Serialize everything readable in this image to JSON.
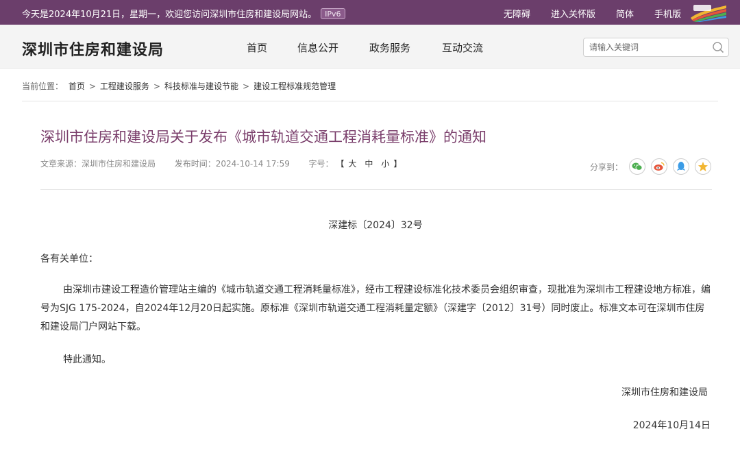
{
  "topbar": {
    "welcome": "今天是2024年10月21日，星期一，欢迎您访问深圳市住房和建设局网站。",
    "ipv6_badge": "IPv6",
    "links": [
      "无障碍",
      "进入关怀版",
      "简体",
      "手机版"
    ]
  },
  "header": {
    "site_title": "深圳市住房和建设局",
    "nav": [
      "首页",
      "信息公开",
      "政务服务",
      "互动交流"
    ],
    "search_placeholder": "请输入关键词"
  },
  "breadcrumb": {
    "prefix": "当前位置：",
    "items": [
      "首页",
      "工程建设服务",
      "科技标准与建设节能",
      "建设工程标准规范管理"
    ],
    "separator": ">"
  },
  "article": {
    "title": "深圳市住房和建设局关于发布《城市轨道交通工程消耗量标准》的通知",
    "source_label": "文章来源：",
    "source": "深圳市住房和建设局",
    "date_label": "发布时间：",
    "date": "2024-10-14 17:59",
    "font_label": "字号：",
    "font_open": "【",
    "font_sizes": [
      "大",
      "中",
      "小"
    ],
    "font_close": "】",
    "share_label": "分享到：",
    "share_icons": [
      "wechat-icon",
      "weibo-icon",
      "qq-icon",
      "qzone-icon"
    ],
    "doc_number": "深建标〔2024〕32号",
    "salutation": "各有关单位：",
    "body": "由深圳市建设工程造价管理站主编的《城市轨道交通工程消耗量标准》，经市工程建设标准化技术委员会组织审查，现批准为深圳市工程建设地方标准，编号为SJG 175-2024，自2024年12月20日起实施。原标准《深圳市轨道交通工程消耗量定额》（深建字〔2012〕31号）同时废止。标准文本可在深圳市住房和建设局门户网站下载。",
    "closing": "特此通知。",
    "signature": "深圳市住房和建设局",
    "sign_date": "2024年10月14日"
  },
  "colors": {
    "topbar_bg": "#6b3e6b",
    "title_color": "#7a3e6b",
    "wechat": "#4caf50",
    "weibo": "#e6553a",
    "qq": "#3b9ce6",
    "qzone": "#f2b632"
  }
}
